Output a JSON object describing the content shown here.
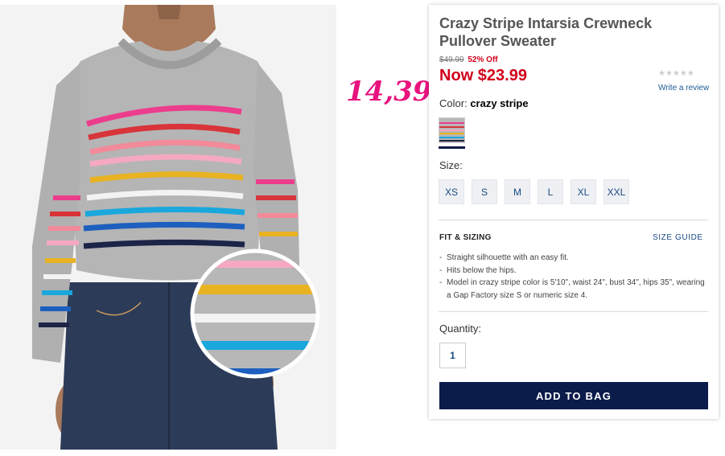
{
  "annotation": {
    "handwritten_price": "14,39",
    "color": "#e8137e"
  },
  "product": {
    "title": "Crazy Stripe Intarsia Crewneck Pullover Sweater",
    "original_price": "$49.99",
    "discount": "52% Off",
    "now_price": "Now $23.99",
    "rating_stars": "★★★★★",
    "rating_value": 0,
    "write_review": "Write a review",
    "color_label": "Color:",
    "color_value": "crazy stripe",
    "size_label": "Size:",
    "sizes": [
      "XS",
      "S",
      "M",
      "L",
      "XL",
      "XXL"
    ],
    "fit_heading": "FIT & SIZING",
    "size_guide": "SIZE GUIDE",
    "fit_details": [
      "Straight silhouette with an easy fit.",
      "Hits below the hips.",
      "Model in crazy stripe color is 5'10\", waist 24\", bust 34\", hips 35\", wearing a Gap Factory size S or numeric size 4."
    ],
    "quantity_label": "Quantity:",
    "quantity_value": "1",
    "add_to_bag": "ADD TO BAG"
  },
  "colors": {
    "sale_red": "#d0021b",
    "navy": "#0b1b4a",
    "link_blue": "#1a4a82",
    "sweater_gray": "#b5b5b5",
    "stripe_pink": "#ec3d8d",
    "stripe_red": "#d8343a",
    "stripe_light_pink": "#f5a9c0",
    "stripe_yellow": "#e8b221",
    "stripe_white": "#f3f3f3",
    "stripe_cyan": "#1aa7dc",
    "stripe_blue": "#1d5fbf",
    "stripe_navy": "#1c2447",
    "denim": "#2c3b58"
  }
}
